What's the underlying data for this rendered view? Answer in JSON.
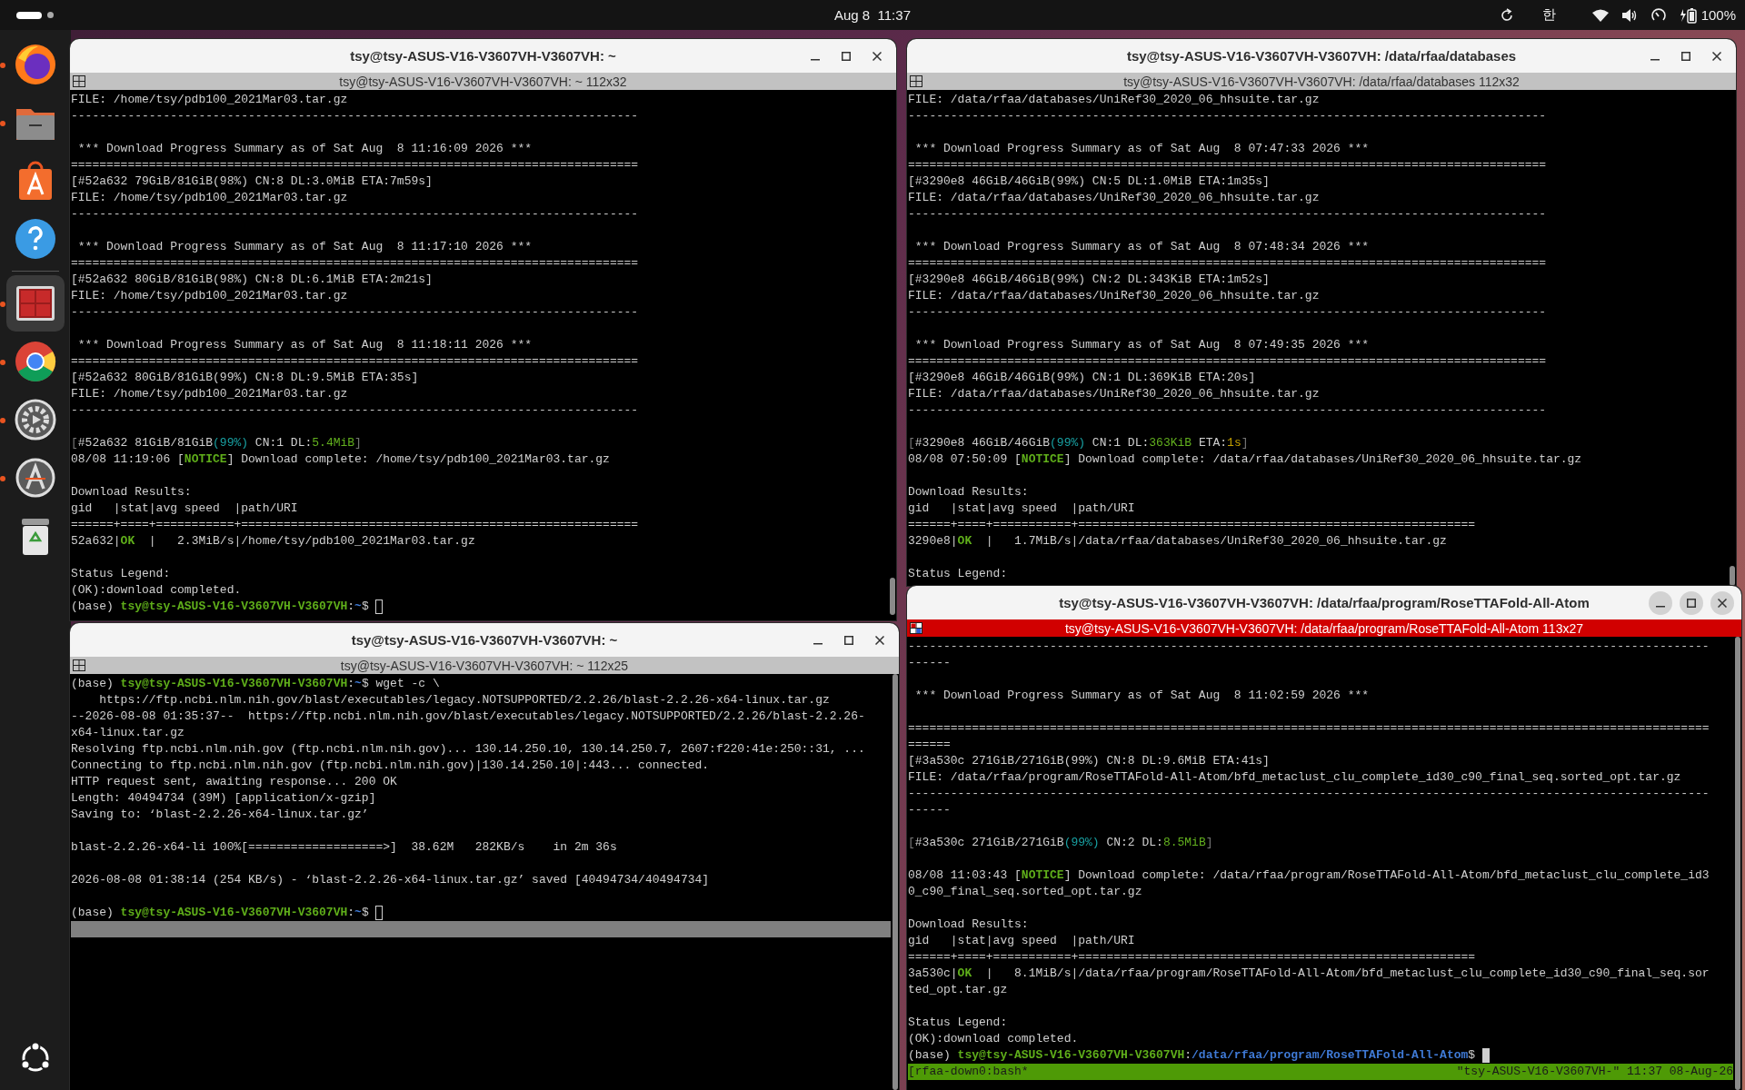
{
  "top_bar": {
    "clock": "Aug 8  11:37",
    "input_method": "한",
    "battery": "100%"
  },
  "dock": {
    "items": [
      {
        "kind": "browser",
        "running": true,
        "selected": false
      },
      {
        "kind": "files",
        "running": true,
        "selected": false
      },
      {
        "kind": "store",
        "running": false,
        "selected": false
      },
      {
        "kind": "help",
        "running": false,
        "selected": false
      },
      {
        "kind": "terminal",
        "running": true,
        "selected": true
      },
      {
        "kind": "wheel",
        "running": true,
        "selected": false
      },
      {
        "kind": "settings",
        "running": true,
        "selected": false
      },
      {
        "kind": "updater",
        "running": true,
        "selected": false
      },
      {
        "kind": "trash",
        "running": false,
        "selected": false
      }
    ]
  },
  "windows": [
    {
      "title": "tsy@tsy-ASUS-V16-V3607VH-V3607VH: ~",
      "tab_title": "tsy@tsy-ASUS-V16-V3607VH-V3607VH: ~ 112x32",
      "focused": false,
      "lines": [
        {
          "parts": [
            {
              "text": "FILE: /home/tsy/pdb100_2021Mar03.tar.gz",
              "kind": "plain"
            }
          ]
        },
        {
          "parts": [
            {
              "text": "--------------------------------------------------------------------------------",
              "kind": "plain"
            }
          ]
        },
        {
          "space_before": true,
          "parts": [
            {
              "text": " *** Download Progress Summary as of Sat Aug  8 11:16:09 2026 ***",
              "kind": "plain"
            }
          ]
        },
        {
          "parts": [
            {
              "text": "================================================================================",
              "kind": "plain"
            }
          ]
        },
        {
          "parts": [
            {
              "text": "[#52a632 79GiB/81GiB(98%) CN:8 DL:3.0MiB ETA:7m59s]",
              "kind": "plain"
            }
          ]
        },
        {
          "parts": [
            {
              "text": "FILE: /home/tsy/pdb100_2021Mar03.tar.gz",
              "kind": "plain"
            }
          ]
        },
        {
          "parts": [
            {
              "text": "--------------------------------------------------------------------------------",
              "kind": "plain"
            }
          ]
        },
        {
          "space_before": true,
          "parts": [
            {
              "text": " *** Download Progress Summary as of Sat Aug  8 11:17:10 2026 ***",
              "kind": "plain"
            }
          ]
        },
        {
          "parts": [
            {
              "text": "================================================================================",
              "kind": "plain"
            }
          ]
        },
        {
          "parts": [
            {
              "text": "[#52a632 80GiB/81GiB(98%) CN:8 DL:6.1MiB ETA:2m21s]",
              "kind": "plain"
            }
          ]
        },
        {
          "parts": [
            {
              "text": "FILE: /home/tsy/pdb100_2021Mar03.tar.gz",
              "kind": "plain"
            }
          ]
        },
        {
          "parts": [
            {
              "text": "--------------------------------------------------------------------------------",
              "kind": "plain"
            }
          ]
        },
        {
          "space_before": true,
          "parts": [
            {
              "text": " *** Download Progress Summary as of Sat Aug  8 11:18:11 2026 ***",
              "kind": "plain"
            }
          ]
        },
        {
          "parts": [
            {
              "text": "================================================================================",
              "kind": "plain"
            }
          ]
        },
        {
          "parts": [
            {
              "text": "[#52a632 80GiB/81GiB(99%) CN:8 DL:9.5MiB ETA:35s]",
              "kind": "plain"
            }
          ]
        },
        {
          "parts": [
            {
              "text": "FILE: /home/tsy/pdb100_2021Mar03.tar.gz",
              "kind": "plain"
            }
          ]
        },
        {
          "parts": [
            {
              "text": "--------------------------------------------------------------------------------",
              "kind": "plain"
            }
          ]
        },
        {
          "space_before": true,
          "parts": [
            {
              "text": "[",
              "kind": "dim"
            },
            {
              "text": "#52a632 81GiB/81GiB",
              "kind": "plain"
            },
            {
              "text": "(99%)",
              "kind": "percent"
            },
            {
              "text": " CN:1 DL:",
              "kind": "plain"
            },
            {
              "text": "5.4MiB",
              "kind": "rate"
            },
            {
              "text": "]",
              "kind": "dim"
            }
          ]
        },
        {
          "parts": [
            {
              "text": "08/08 11:19:06 [",
              "kind": "plain"
            },
            {
              "text": "NOTICE",
              "kind": "notice"
            },
            {
              "text": "] Download complete: /home/tsy/pdb100_2021Mar03.tar.gz",
              "kind": "plain"
            }
          ]
        },
        {
          "space_before": true,
          "parts": [
            {
              "text": "Download Results:",
              "kind": "plain"
            }
          ]
        },
        {
          "parts": [
            {
              "text": "gid   |stat|avg speed  |path/URI",
              "kind": "plain"
            }
          ]
        },
        {
          "parts": [
            {
              "text": "======+====+===========+========================================================",
              "kind": "plain"
            }
          ]
        },
        {
          "parts": [
            {
              "text": "52a632|",
              "kind": "plain"
            },
            {
              "text": "OK",
              "kind": "ok"
            },
            {
              "text": "  |   2.3MiB/s|/home/tsy/pdb100_2021Mar03.tar.gz",
              "kind": "plain"
            }
          ]
        },
        {
          "space_before": true,
          "parts": [
            {
              "text": "Status Legend:",
              "kind": "plain"
            }
          ]
        },
        {
          "parts": [
            {
              "text": "(OK):download completed.",
              "kind": "plain"
            }
          ]
        },
        {
          "cursor": true,
          "cursor_filled": false,
          "parts": [
            {
              "text": "(base) ",
              "kind": "plain"
            },
            {
              "text": "tsy@tsy-ASUS-V16-V3607VH-V3607VH",
              "kind": "user"
            },
            {
              "text": ":",
              "kind": "plain"
            },
            {
              "text": "~",
              "kind": "path"
            },
            {
              "text": "$ ",
              "kind": "plain"
            }
          ]
        }
      ]
    },
    {
      "title": "tsy@tsy-ASUS-V16-V3607VH-V3607VH: ~",
      "tab_title": "tsy@tsy-ASUS-V16-V3607VH-V3607VH: ~ 112x25",
      "focused": false,
      "lines": [
        {
          "parts": [
            {
              "text": "(base) ",
              "kind": "plain"
            },
            {
              "text": "tsy@tsy-ASUS-V16-V3607VH-V3607VH",
              "kind": "user"
            },
            {
              "text": ":",
              "kind": "plain"
            },
            {
              "text": "~",
              "kind": "path"
            },
            {
              "text": "$ wget -c \\",
              "kind": "plain"
            }
          ]
        },
        {
          "parts": [
            {
              "text": "    https://ftp.ncbi.nlm.nih.gov/blast/executables/legacy.NOTSUPPORTED/2.2.26/blast-2.2.26-x64-linux.tar.gz",
              "kind": "plain"
            }
          ]
        },
        {
          "parts": [
            {
              "text": "--2026-08-08 01:35:37--  https://ftp.ncbi.nlm.nih.gov/blast/executables/legacy.NOTSUPPORTED/2.2.26/blast-2.2.26-",
              "kind": "plain"
            }
          ]
        },
        {
          "parts": [
            {
              "text": "x64-linux.tar.gz",
              "kind": "plain"
            }
          ]
        },
        {
          "parts": [
            {
              "text": "Resolving ftp.ncbi.nlm.nih.gov (ftp.ncbi.nlm.nih.gov)... 130.14.250.10, 130.14.250.7, 2607:f220:41e:250::31, ...",
              "kind": "plain"
            }
          ]
        },
        {
          "parts": [
            {
              "text": "Connecting to ftp.ncbi.nlm.nih.gov (ftp.ncbi.nlm.nih.gov)|130.14.250.10|:443... connected.",
              "kind": "plain"
            }
          ]
        },
        {
          "parts": [
            {
              "text": "HTTP request sent, awaiting response... 200 OK",
              "kind": "plain"
            }
          ]
        },
        {
          "parts": [
            {
              "text": "Length: 40494734 (39M) [application/x-gzip]",
              "kind": "plain"
            }
          ]
        },
        {
          "parts": [
            {
              "text": "Saving to: ‘blast-2.2.26-x64-linux.tar.gz’",
              "kind": "plain"
            }
          ]
        },
        {
          "space_before": true,
          "parts": [
            {
              "text": "blast-2.2.26-x64-li 100%[===================>]  38.62M   282KB/s    in 2m 36s",
              "kind": "plain"
            }
          ]
        },
        {
          "space_before": true,
          "parts": [
            {
              "text": "2026-08-08 01:38:14 (254 KB/s) - ‘blast-2.2.26-x64-linux.tar.gz’ saved [40494734/40494734]",
              "kind": "plain"
            }
          ]
        },
        {
          "space_before": true,
          "cursor": true,
          "cursor_filled": false,
          "parts": [
            {
              "text": "(base) ",
              "kind": "plain"
            },
            {
              "text": "tsy@tsy-ASUS-V16-V3607VH-V3607VH",
              "kind": "user"
            },
            {
              "text": ":",
              "kind": "plain"
            },
            {
              "text": "~",
              "kind": "path"
            },
            {
              "text": "$ ",
              "kind": "plain"
            }
          ]
        }
      ],
      "footer": {
        "kind": "strip"
      }
    },
    {
      "title": "tsy@tsy-ASUS-V16-V3607VH-V3607VH: /data/rfaa/databases",
      "tab_title": "tsy@tsy-ASUS-V16-V3607VH-V3607VH: /data/rfaa/databases 112x32",
      "focused": false,
      "lines": [
        {
          "parts": [
            {
              "text": "FILE: /data/rfaa/databases/UniRef30_2020_06_hhsuite.tar.gz",
              "kind": "plain"
            }
          ]
        },
        {
          "parts": [
            {
              "text": "------------------------------------------------------------------------------------------",
              "kind": "plain"
            }
          ]
        },
        {
          "space_before": true,
          "parts": [
            {
              "text": " *** Download Progress Summary as of Sat Aug  8 07:47:33 2026 ***",
              "kind": "plain"
            }
          ]
        },
        {
          "parts": [
            {
              "text": "==========================================================================================",
              "kind": "plain"
            }
          ]
        },
        {
          "parts": [
            {
              "text": "[#3290e8 46GiB/46GiB(99%) CN:5 DL:1.0MiB ETA:1m35s]",
              "kind": "plain"
            }
          ]
        },
        {
          "parts": [
            {
              "text": "FILE: /data/rfaa/databases/UniRef30_2020_06_hhsuite.tar.gz",
              "kind": "plain"
            }
          ]
        },
        {
          "parts": [
            {
              "text": "------------------------------------------------------------------------------------------",
              "kind": "plain"
            }
          ]
        },
        {
          "space_before": true,
          "parts": [
            {
              "text": " *** Download Progress Summary as of Sat Aug  8 07:48:34 2026 ***",
              "kind": "plain"
            }
          ]
        },
        {
          "parts": [
            {
              "text": "==========================================================================================",
              "kind": "plain"
            }
          ]
        },
        {
          "parts": [
            {
              "text": "[#3290e8 46GiB/46GiB(99%) CN:2 DL:343KiB ETA:1m52s]",
              "kind": "plain"
            }
          ]
        },
        {
          "parts": [
            {
              "text": "FILE: /data/rfaa/databases/UniRef30_2020_06_hhsuite.tar.gz",
              "kind": "plain"
            }
          ]
        },
        {
          "parts": [
            {
              "text": "------------------------------------------------------------------------------------------",
              "kind": "plain"
            }
          ]
        },
        {
          "space_before": true,
          "parts": [
            {
              "text": " *** Download Progress Summary as of Sat Aug  8 07:49:35 2026 ***",
              "kind": "plain"
            }
          ]
        },
        {
          "parts": [
            {
              "text": "==========================================================================================",
              "kind": "plain"
            }
          ]
        },
        {
          "parts": [
            {
              "text": "[#3290e8 46GiB/46GiB(99%) CN:1 DL:369KiB ETA:20s]",
              "kind": "plain"
            }
          ]
        },
        {
          "parts": [
            {
              "text": "FILE: /data/rfaa/databases/UniRef30_2020_06_hhsuite.tar.gz",
              "kind": "plain"
            }
          ]
        },
        {
          "parts": [
            {
              "text": "------------------------------------------------------------------------------------------",
              "kind": "plain"
            }
          ]
        },
        {
          "space_before": true,
          "parts": [
            {
              "text": "[",
              "kind": "dim"
            },
            {
              "text": "#3290e8 46GiB/46GiB",
              "kind": "plain"
            },
            {
              "text": "(99%)",
              "kind": "percent"
            },
            {
              "text": " CN:1 DL:",
              "kind": "plain"
            },
            {
              "text": "363KiB",
              "kind": "rate"
            },
            {
              "text": " ETA:",
              "kind": "plain"
            },
            {
              "text": "1s",
              "kind": "eta"
            },
            {
              "text": "]",
              "kind": "dim"
            }
          ]
        },
        {
          "parts": [
            {
              "text": "08/08 07:50:09 [",
              "kind": "plain"
            },
            {
              "text": "NOTICE",
              "kind": "notice"
            },
            {
              "text": "] Download complete: /data/rfaa/databases/UniRef30_2020_06_hhsuite.tar.gz",
              "kind": "plain"
            }
          ]
        },
        {
          "space_before": true,
          "parts": [
            {
              "text": "Download Results:",
              "kind": "plain"
            }
          ]
        },
        {
          "parts": [
            {
              "text": "gid   |stat|avg speed  |path/URI",
              "kind": "plain"
            }
          ]
        },
        {
          "parts": [
            {
              "text": "======+====+===========+========================================================",
              "kind": "plain"
            }
          ]
        },
        {
          "parts": [
            {
              "text": "3290e8|",
              "kind": "plain"
            },
            {
              "text": "OK",
              "kind": "ok"
            },
            {
              "text": "  |   1.7MiB/s|/data/rfaa/databases/UniRef30_2020_06_hhsuite.tar.gz",
              "kind": "plain"
            }
          ]
        },
        {
          "space_before": true,
          "parts": [
            {
              "text": "Status Legend:",
              "kind": "plain"
            }
          ]
        }
      ]
    },
    {
      "title": "tsy@tsy-ASUS-V16-V3607VH-V3607VH: /data/rfaa/program/RoseTTAFold-All-Atom",
      "tab_title": "tsy@tsy-ASUS-V16-V3607VH-V3607VH: /data/rfaa/program/RoseTTAFold-All-Atom 113x27",
      "focused": true,
      "lines": [
        {
          "parts": [
            {
              "text": "-----------------------------------------------------------------------------------------------------------------",
              "kind": "plain"
            }
          ]
        },
        {
          "parts": [
            {
              "text": "------",
              "kind": "plain"
            }
          ]
        },
        {
          "space_before": true,
          "parts": [
            {
              "text": " *** Download Progress Summary as of Sat Aug  8 11:02:59 2026 ***",
              "kind": "plain"
            }
          ]
        },
        {
          "space_before": true,
          "parts": [
            {
              "text": "=================================================================================================================",
              "kind": "plain"
            }
          ]
        },
        {
          "parts": [
            {
              "text": "======",
              "kind": "plain"
            }
          ]
        },
        {
          "parts": [
            {
              "text": "[#3a530c 271GiB/271GiB(99%) CN:8 DL:9.6MiB ETA:41s]",
              "kind": "plain"
            }
          ]
        },
        {
          "parts": [
            {
              "text": "FILE: /data/rfaa/program/RoseTTAFold-All-Atom/bfd_metaclust_clu_complete_id30_c90_final_seq.sorted_opt.tar.gz",
              "kind": "plain"
            }
          ]
        },
        {
          "parts": [
            {
              "text": "-----------------------------------------------------------------------------------------------------------------",
              "kind": "plain"
            }
          ]
        },
        {
          "parts": [
            {
              "text": "------",
              "kind": "plain"
            }
          ]
        },
        {
          "space_before": true,
          "parts": [
            {
              "text": "[",
              "kind": "dim"
            },
            {
              "text": "#3a530c 271GiB/271GiB",
              "kind": "plain"
            },
            {
              "text": "(99%)",
              "kind": "percent"
            },
            {
              "text": " CN:2 DL:",
              "kind": "plain"
            },
            {
              "text": "8.5MiB",
              "kind": "rate"
            },
            {
              "text": "]",
              "kind": "dim"
            }
          ]
        },
        {
          "space_before": true,
          "parts": [
            {
              "text": "08/08 11:03:43 [",
              "kind": "plain"
            },
            {
              "text": "NOTICE",
              "kind": "notice"
            },
            {
              "text": "] Download complete: /data/rfaa/program/RoseTTAFold-All-Atom/bfd_metaclust_clu_complete_id3",
              "kind": "plain"
            }
          ]
        },
        {
          "parts": [
            {
              "text": "0_c90_final_seq.sorted_opt.tar.gz",
              "kind": "plain"
            }
          ]
        },
        {
          "space_before": true,
          "parts": [
            {
              "text": "Download Results:",
              "kind": "plain"
            }
          ]
        },
        {
          "parts": [
            {
              "text": "gid   |stat|avg speed  |path/URI",
              "kind": "plain"
            }
          ]
        },
        {
          "parts": [
            {
              "text": "======+====+===========+========================================================",
              "kind": "plain"
            }
          ]
        },
        {
          "parts": [
            {
              "text": "3a530c|",
              "kind": "plain"
            },
            {
              "text": "OK",
              "kind": "ok"
            },
            {
              "text": "  |   8.1MiB/s|/data/rfaa/program/RoseTTAFold-All-Atom/bfd_metaclust_clu_complete_id30_c90_final_seq.sor",
              "kind": "plain"
            }
          ]
        },
        {
          "parts": [
            {
              "text": "ted_opt.tar.gz",
              "kind": "plain"
            }
          ]
        },
        {
          "space_before": true,
          "parts": [
            {
              "text": "Status Legend:",
              "kind": "plain"
            }
          ]
        },
        {
          "parts": [
            {
              "text": "(OK):download completed.",
              "kind": "plain"
            }
          ]
        },
        {
          "cursor": true,
          "cursor_filled": true,
          "parts": [
            {
              "text": "(base) ",
              "kind": "plain"
            },
            {
              "text": "tsy@tsy-ASUS-V16-V3607VH-V3607VH",
              "kind": "user"
            },
            {
              "text": ":",
              "kind": "plain"
            },
            {
              "text": "/data/rfaa/program/RoseTTAFold-All-Atom",
              "kind": "path"
            },
            {
              "text": "$ ",
              "kind": "plain"
            }
          ]
        }
      ],
      "footer": {
        "kind": "status",
        "left": "[rfaa-down0:bash*",
        "right": "\"tsy-ASUS-V16-V3607VH-\" 11:37 08-Aug-26"
      }
    }
  ]
}
